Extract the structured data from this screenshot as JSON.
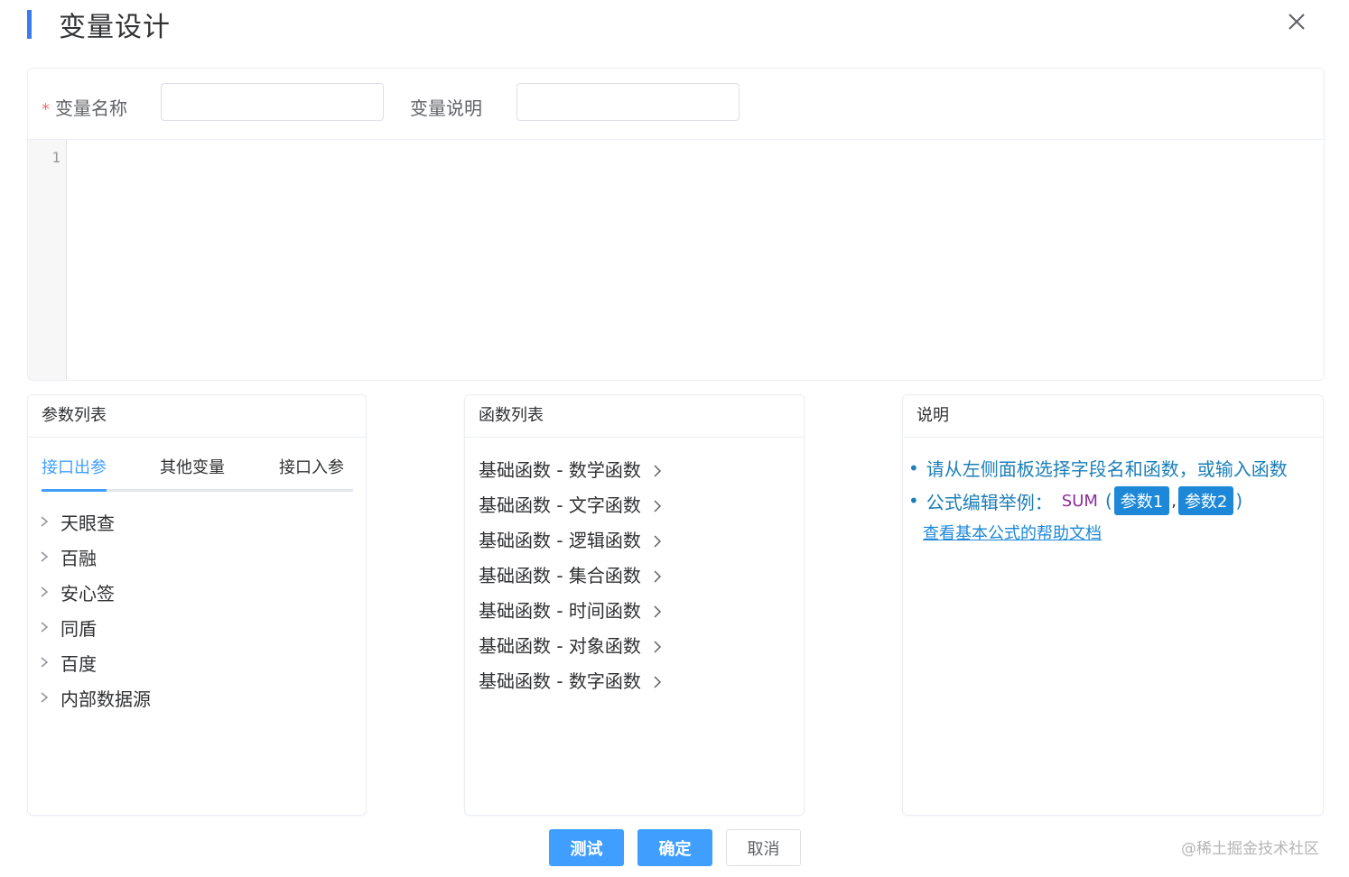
{
  "dialog": {
    "title": "变量设计",
    "accent_color": "#3a7bf0",
    "close_icon": "close-icon"
  },
  "form": {
    "name_required_mark": "*",
    "name_label": "变量名称",
    "name_value": "",
    "desc_label": "变量说明",
    "desc_value": ""
  },
  "editor": {
    "line_numbers": [
      "1"
    ],
    "content": ""
  },
  "params_panel": {
    "title": "参数列表",
    "tabs": [
      {
        "label": "接口出参",
        "active": true
      },
      {
        "label": "其他变量",
        "active": false
      },
      {
        "label": "接口入参",
        "active": false
      }
    ],
    "items": [
      {
        "label": "天眼查"
      },
      {
        "label": "百融"
      },
      {
        "label": "安心签"
      },
      {
        "label": "同盾"
      },
      {
        "label": "百度"
      },
      {
        "label": "内部数据源"
      }
    ]
  },
  "functions_panel": {
    "title": "函数列表",
    "items": [
      {
        "label": "基础函数 - 数学函数"
      },
      {
        "label": "基础函数 - 文字函数"
      },
      {
        "label": "基础函数 - 逻辑函数"
      },
      {
        "label": "基础函数 - 集合函数"
      },
      {
        "label": "基础函数 - 时间函数"
      },
      {
        "label": "基础函数 - 对象函数"
      },
      {
        "label": "基础函数 - 数字函数"
      }
    ]
  },
  "desc_panel": {
    "title": "说明",
    "bullet": "•",
    "line1": "请从左侧面板选择字段名和函数，或输入函数",
    "line2_label": "公式编辑举例：",
    "example_fn": "SUM",
    "paren_open": "(",
    "param1": "参数1",
    "comma": ",",
    "param2": "参数2",
    "paren_close": ")",
    "help_link": "查看基本公式的帮助文档"
  },
  "footer": {
    "test_label": "测试",
    "confirm_label": "确定",
    "cancel_label": "取消"
  },
  "watermark": "@稀土掘金技术社区",
  "colors": {
    "primary": "#409eff",
    "required": "#f56c6c",
    "desc_text": "#1c7fb8",
    "fn_name": "#8e2d9b",
    "tag_bg": "#1e88d8"
  }
}
